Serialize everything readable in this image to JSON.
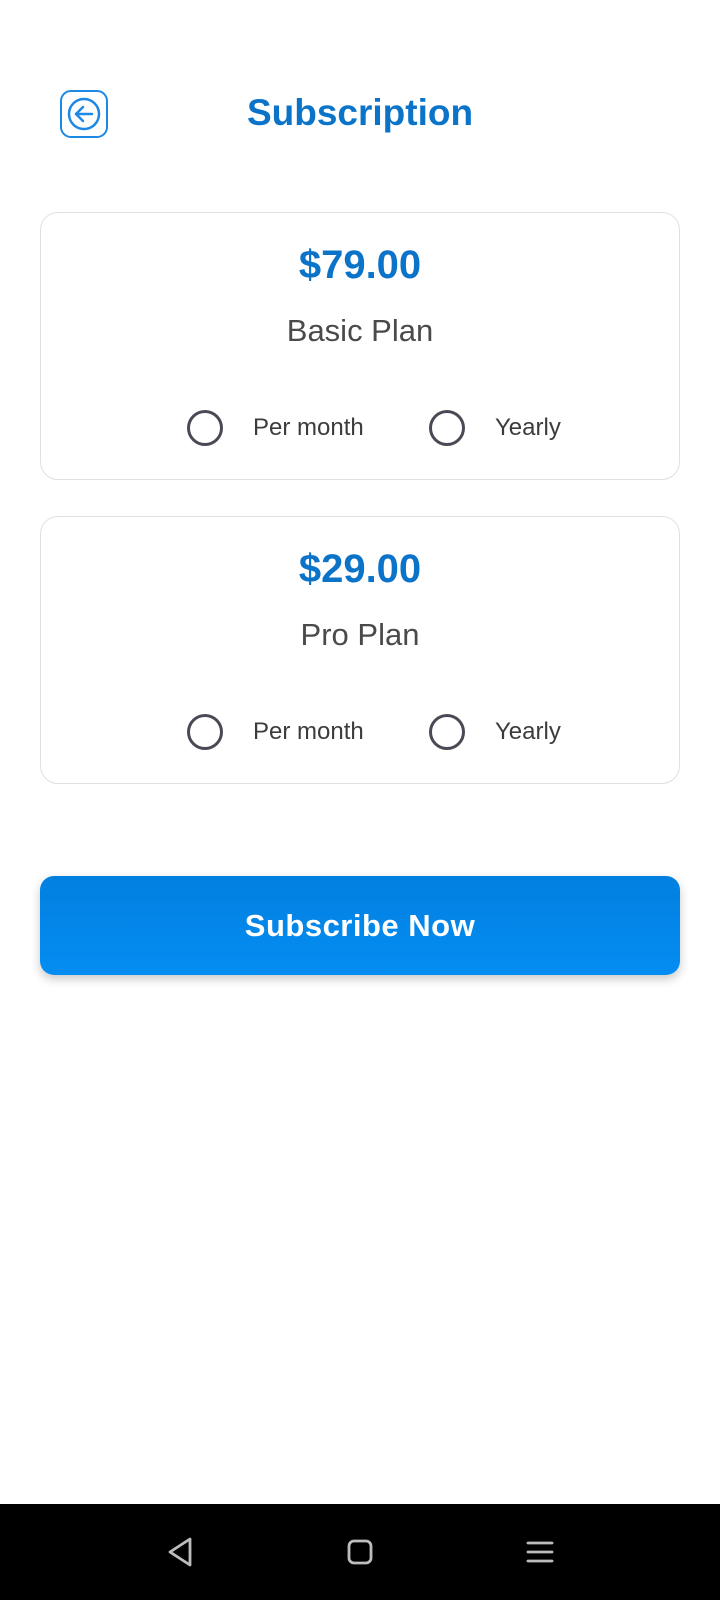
{
  "header": {
    "title": "Subscription",
    "back_icon": "arrow-left-icon"
  },
  "colors": {
    "accent": "#0b74c9",
    "button": "#0288e8",
    "text": "#4a4a4a"
  },
  "plans": [
    {
      "price": "$79.00",
      "name": "Basic Plan",
      "options": [
        {
          "label": "Per month",
          "selected": false
        },
        {
          "label": "Yearly",
          "selected": false
        }
      ]
    },
    {
      "price": "$29.00",
      "name": "Pro Plan",
      "options": [
        {
          "label": "Per month",
          "selected": false
        },
        {
          "label": "Yearly",
          "selected": false
        }
      ]
    }
  ],
  "subscribe": {
    "label": "Subscribe Now"
  },
  "navbar": {
    "icons": [
      "nav-back-icon",
      "nav-home-icon",
      "nav-menu-icon"
    ]
  }
}
